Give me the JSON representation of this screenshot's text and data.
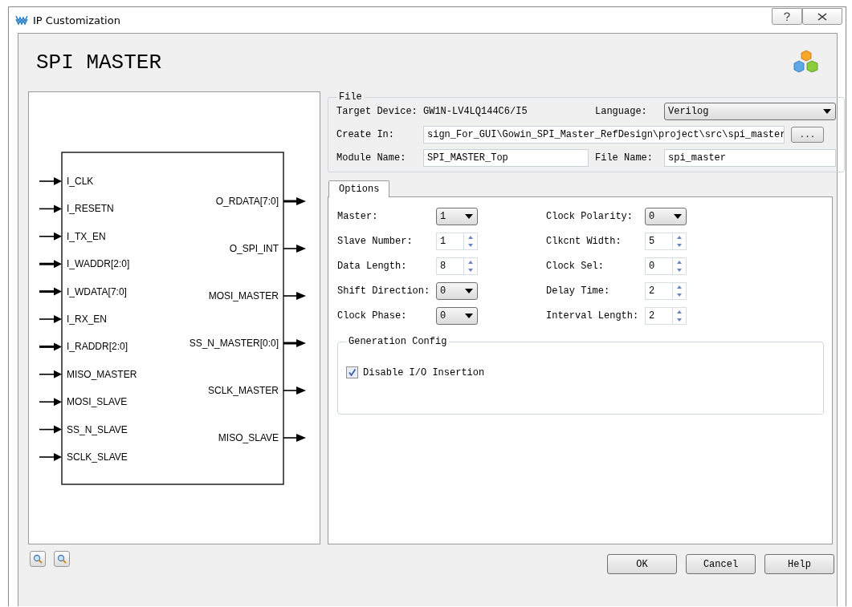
{
  "window": {
    "title": "IP Customization"
  },
  "header": {
    "title": "SPI MASTER"
  },
  "diagram": {
    "inputs": [
      {
        "name": "I_CLK",
        "bus": false
      },
      {
        "name": "I_RESETN",
        "bus": false
      },
      {
        "name": "I_TX_EN",
        "bus": false
      },
      {
        "name": "I_WADDR[2:0]",
        "bus": true
      },
      {
        "name": "I_WDATA[7:0]",
        "bus": true
      },
      {
        "name": "I_RX_EN",
        "bus": false
      },
      {
        "name": "I_RADDR[2:0]",
        "bus": true
      },
      {
        "name": "MISO_MASTER",
        "bus": false
      },
      {
        "name": "MOSI_SLAVE",
        "bus": false
      },
      {
        "name": "SS_N_SLAVE",
        "bus": false
      },
      {
        "name": "SCLK_SLAVE",
        "bus": false
      }
    ],
    "outputs": [
      {
        "name": "O_RDATA[7:0]",
        "bus": true
      },
      {
        "name": "O_SPI_INT",
        "bus": false
      },
      {
        "name": "MOSI_MASTER",
        "bus": false
      },
      {
        "name": "SS_N_MASTER[0:0]",
        "bus": true
      },
      {
        "name": "SCLK_MASTER",
        "bus": false
      },
      {
        "name": "MISO_SLAVE",
        "bus": false
      }
    ]
  },
  "file": {
    "legend": "File",
    "target_device_label": "Target Device:",
    "target_device": "GW1N-LV4LQ144C6/I5",
    "language_label": "Language:",
    "language": "Verilog",
    "create_in_label": "Create In:",
    "create_in": "sign_For_GUI\\Gowin_SPI_Master_RefDesign\\project\\src\\spi_master",
    "browse": "...",
    "module_name_label": "Module Name:",
    "module_name": "SPI_MASTER_Top",
    "file_name_label": "File Name:",
    "file_name": "spi_master"
  },
  "tabs": [
    {
      "label": "Options",
      "selected": true
    }
  ],
  "options": {
    "left": [
      {
        "label": "Master:",
        "kind": "dropdown",
        "value": "1"
      },
      {
        "label": "Slave Number:",
        "kind": "spinner",
        "value": "1"
      },
      {
        "label": "Data Length:",
        "kind": "spinner",
        "value": "8"
      },
      {
        "label": "Shift Direction:",
        "kind": "dropdown",
        "value": "0"
      },
      {
        "label": "Clock Phase:",
        "kind": "dropdown",
        "value": "0"
      }
    ],
    "right": [
      {
        "label": "Clock Polarity:",
        "kind": "dropdown",
        "value": "0"
      },
      {
        "label": "Clkcnt Width:",
        "kind": "spinner",
        "value": "5"
      },
      {
        "label": "Clock Sel:",
        "kind": "spinner",
        "value": "0"
      },
      {
        "label": "Delay Time:",
        "kind": "spinner",
        "value": "2"
      },
      {
        "label": "Interval Length:",
        "kind": "spinner",
        "value": "2"
      }
    ]
  },
  "generation": {
    "legend": "Generation Config",
    "checkbox": {
      "label": "Disable I/O Insertion",
      "checked": true
    }
  },
  "buttons": [
    "OK",
    "Cancel",
    "Help"
  ]
}
